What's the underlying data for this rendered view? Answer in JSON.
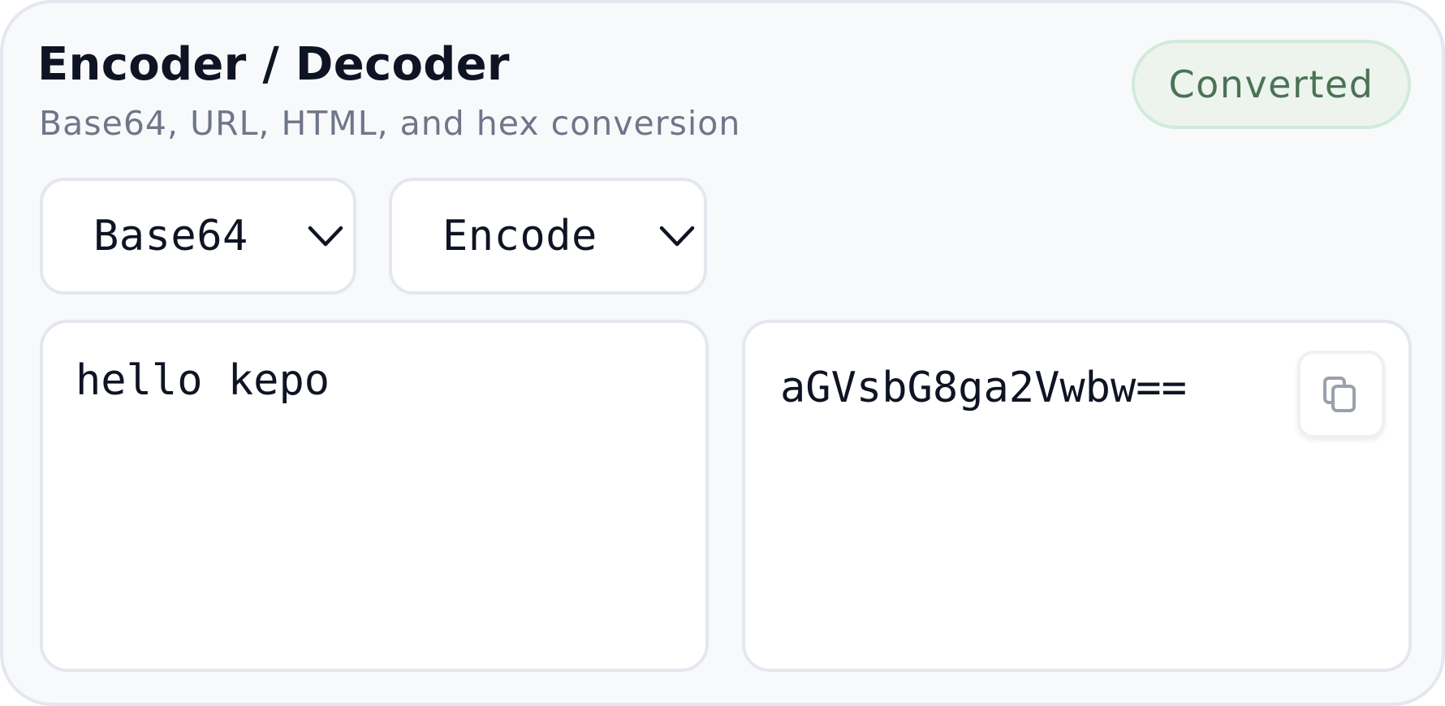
{
  "header": {
    "title": "Encoder / Decoder",
    "subtitle": "Base64, URL, HTML, and hex conversion",
    "status_badge": "Converted"
  },
  "controls": {
    "type_select": {
      "value": "Base64",
      "icon": "chevron-down-icon"
    },
    "mode_select": {
      "value": "Encode",
      "icon": "chevron-down-icon"
    }
  },
  "input": {
    "value": "hello kepo"
  },
  "output": {
    "value": "aGVsbG8ga2Vwbw==",
    "copy_icon": "copy-icon"
  },
  "colors": {
    "card_background": "#f8f9fb",
    "border": "#e4e7ee",
    "title": "#0f1424",
    "subtitle": "#6f7689",
    "badge_background": "#edf4ee",
    "badge_border": "#d2eadb",
    "badge_text": "#4b7355",
    "copy_icon": "#9aa0ad"
  }
}
